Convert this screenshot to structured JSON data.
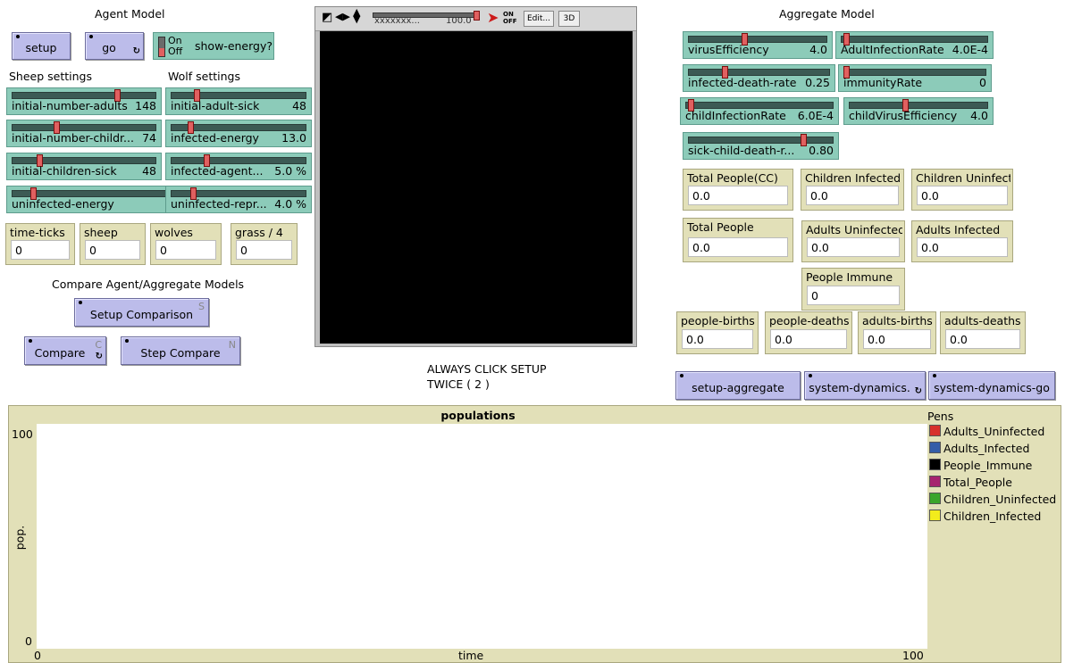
{
  "headings": {
    "agent_model": "Agent Model",
    "aggregate_model": "Aggregate Model",
    "sheep_settings": "Sheep settings",
    "wolf_settings": "Wolf settings",
    "compare_models": "Compare Agent/Aggregate Models",
    "always_click_1": "ALWAYS CLICK SETUP",
    "always_click_2": "TWICE ( 2 )"
  },
  "buttons": {
    "setup": "setup",
    "go": "go",
    "setup_comparison": "Setup Comparison",
    "setup_comparison_key": "S",
    "compare": "Compare",
    "compare_key": "C",
    "step_compare": "Step Compare",
    "step_compare_key": "N",
    "setup_aggregate": "setup-aggregate",
    "system_dynamics": "system-dynamics.",
    "system_dynamics_go": "system-dynamics-go"
  },
  "switch": {
    "on": "On",
    "off": "Off",
    "label": "show-energy?"
  },
  "sliders": {
    "initial_number_adults": {
      "name": "initial-number-adults",
      "value": "148",
      "level": 0.74
    },
    "initial_number_children": {
      "name": "initial-number-childr...",
      "value": "74",
      "level": 0.3
    },
    "initial_children_sick": {
      "name": "initial-children-sick",
      "value": "48",
      "level": 0.18
    },
    "uninfected_energy": {
      "name": "uninfected-energy",
      "value": "",
      "level": 0.1
    },
    "initial_adult_sick": {
      "name": "initial-adult-sick",
      "value": "48",
      "level": 0.18
    },
    "infected_energy": {
      "name": "infected-energy",
      "value": "13.0",
      "level": 0.13
    },
    "infected_agent": {
      "name": "infected-agent...",
      "value": "5.0 %",
      "level": 0.25
    },
    "uninfected_repr": {
      "name": "uninfected-repr...",
      "value": "4.0 %",
      "level": 0.15
    },
    "virus_efficiency": {
      "name": "virusEfficiency",
      "value": "4.0",
      "level": 0.4
    },
    "adult_infection_rate": {
      "name": "AdultInfectionRate",
      "value": "4.0E-4",
      "level": 0.02
    },
    "infected_death_rate": {
      "name": "infected-death-rate",
      "value": "0.25",
      "level": 0.25
    },
    "immunity_rate": {
      "name": "immunityRate",
      "value": "0",
      "level": 0.0
    },
    "child_infection_rate": {
      "name": "childInfectionRate",
      "value": "6.0E-4",
      "level": 0.02
    },
    "child_virus_efficiency": {
      "name": "childVirusEfficiency",
      "value": "4.0",
      "level": 0.4
    },
    "sick_child_death": {
      "name": "sick-child-death-r...",
      "value": "0.80",
      "level": 0.8
    }
  },
  "monitors": {
    "time_ticks": {
      "name": "time-ticks",
      "value": "0"
    },
    "sheep": {
      "name": "sheep",
      "value": "0"
    },
    "wolves": {
      "name": "wolves",
      "value": "0"
    },
    "grass": {
      "name": "grass / 4",
      "value": "0"
    },
    "total_people_cc": {
      "name": "Total People(CC)",
      "value": "0.0"
    },
    "children_infected": {
      "name": "Children Infected",
      "value": "0.0"
    },
    "children_uninfected": {
      "name": "Children Uninfect",
      "value": "0.0"
    },
    "total_people": {
      "name": "Total People",
      "value": "0.0"
    },
    "adults_uninfected": {
      "name": "Adults Uninfected",
      "value": "0.0"
    },
    "adults_infected": {
      "name": "Adults Infected",
      "value": "0.0"
    },
    "people_immune": {
      "name": "People Immune",
      "value": "0"
    },
    "people_births": {
      "name": "people-births",
      "value": "0.0"
    },
    "people_deaths": {
      "name": "people-deaths",
      "value": "0.0"
    },
    "adults_births": {
      "name": "adults-births",
      "value": "0.0"
    },
    "adults_deaths": {
      "name": "adults-deaths",
      "value": "0.0"
    }
  },
  "view_controls": {
    "speed_text": "100.0",
    "tick_label": "xxxxxxx...",
    "on_off": "ON OFF",
    "edit": "Edit...",
    "three_d": "3D"
  },
  "plot": {
    "title": "populations",
    "xlabel": "time",
    "ylabel": "pop.",
    "x_min": "0",
    "x_max": "100",
    "y_min": "0",
    "y_max": "100",
    "pens_title": "Pens",
    "pens": [
      {
        "name": "Adults_Uninfected",
        "color": "#d7302c"
      },
      {
        "name": "Adults_Infected",
        "color": "#345da8"
      },
      {
        "name": "People_Immune",
        "color": "#000000"
      },
      {
        "name": "Total_People",
        "color": "#a6236f"
      },
      {
        "name": "Children_Uninfected",
        "color": "#3aa52b"
      },
      {
        "name": "Children_Infected",
        "color": "#f2ec1c"
      }
    ]
  },
  "chart_data": {
    "type": "line",
    "title": "populations",
    "xlabel": "time",
    "ylabel": "pop.",
    "xlim": [
      0,
      100
    ],
    "ylim": [
      0,
      100
    ],
    "legend": "right",
    "series": [
      {
        "name": "Adults_Uninfected",
        "values": []
      },
      {
        "name": "Adults_Infected",
        "values": []
      },
      {
        "name": "People_Immune",
        "values": []
      },
      {
        "name": "Total_People",
        "values": []
      },
      {
        "name": "Children_Uninfected",
        "values": []
      },
      {
        "name": "Children_Infected",
        "values": []
      }
    ]
  }
}
